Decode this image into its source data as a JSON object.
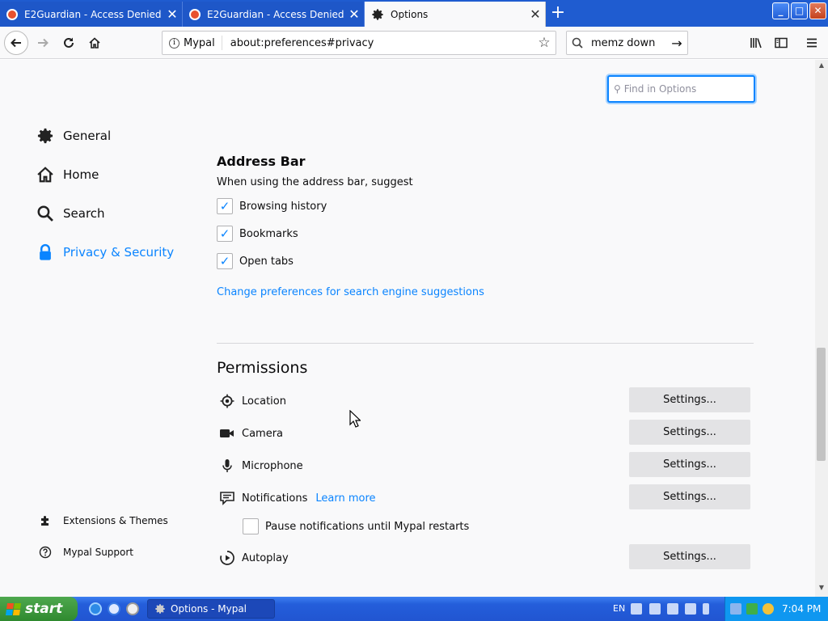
{
  "tabs": [
    {
      "title": "E2Guardian - Access Denied",
      "close": "✕"
    },
    {
      "title": "E2Guardian - Access Denied",
      "close": "✕"
    },
    {
      "title": "Options",
      "close": "✕"
    }
  ],
  "new_tab": "+",
  "window_controls": {
    "minimize": "_",
    "maximize": "□",
    "close": "✕"
  },
  "urlbar": {
    "identity": "Mypal",
    "url": "about:preferences#privacy",
    "info_icon": "i",
    "star": "☆"
  },
  "searchbar": {
    "value": "memz down",
    "go": "→"
  },
  "find": {
    "placeholder": "Find in Options",
    "icon": "⚲"
  },
  "sidebar": {
    "items": [
      {
        "label": "General",
        "icon": "gear-icon"
      },
      {
        "label": "Home",
        "icon": "home-icon"
      },
      {
        "label": "Search",
        "icon": "search-icon"
      },
      {
        "label": "Privacy & Security",
        "icon": "lock-icon"
      }
    ],
    "footer": [
      {
        "label": "Extensions & Themes",
        "icon": "puzzle-icon"
      },
      {
        "label": "Mypal Support",
        "icon": "help-icon"
      }
    ]
  },
  "address_bar": {
    "heading": "Address Bar",
    "intro": "When using the address bar, suggest",
    "options": [
      {
        "label": "Browsing history",
        "checked": true
      },
      {
        "label": "Bookmarks",
        "checked": true
      },
      {
        "label": "Open tabs",
        "checked": true
      }
    ],
    "link": "Change preferences for search engine suggestions"
  },
  "permissions": {
    "heading": "Permissions",
    "items": [
      {
        "label": "Location",
        "button": "Settings..."
      },
      {
        "label": "Camera",
        "button": "Settings..."
      },
      {
        "label": "Microphone",
        "button": "Settings..."
      },
      {
        "label": "Notifications",
        "button": "Settings...",
        "link": "Learn more"
      },
      {
        "label": "Autoplay",
        "button": "Settings..."
      }
    ],
    "pause_notifications": {
      "label": "Pause notifications until Mypal restarts",
      "checked": false
    }
  },
  "taskbar": {
    "start": "start",
    "task": "Options - Mypal",
    "lang": "EN",
    "clock": "7:04 PM"
  },
  "colors": {
    "accent": "#0a84ff",
    "tabstrip": "#1f5cd0",
    "taskbar": "#245edb"
  }
}
